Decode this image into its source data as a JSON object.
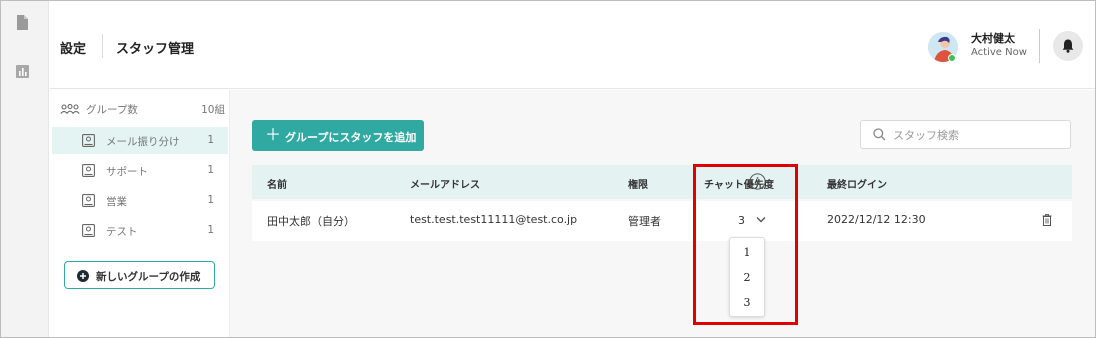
{
  "header": {
    "breadcrumb": [
      "設定",
      "スタッフ管理"
    ],
    "user": {
      "name": "大村健太",
      "status": "Active Now"
    }
  },
  "rail": {
    "icons": [
      "document-icon",
      "chart-icon"
    ]
  },
  "groups_panel": {
    "header_label": "グループ数",
    "count": "10組",
    "items": [
      {
        "label": "メール振り分け",
        "count": "1",
        "active": true
      },
      {
        "label": "サポート",
        "count": "1",
        "active": false
      },
      {
        "label": "営業",
        "count": "1",
        "active": false
      },
      {
        "label": "テスト",
        "count": "1",
        "active": false
      }
    ],
    "new_group_button": "新しいグループの作成"
  },
  "main": {
    "add_staff_button": "グループにスタッフを追加",
    "search_placeholder": "スタッフ検索",
    "table": {
      "columns": [
        "名前",
        "メールアドレス",
        "権限",
        "チャット優先度",
        "最終ログイン"
      ],
      "rows": [
        {
          "name": "田中太郎（自分）",
          "email": "test.test.test11111@test.co.jp",
          "role": "管理者",
          "priority": "3",
          "last_login": "2022/12/12 12:30"
        }
      ]
    },
    "priority_options": [
      "1",
      "2",
      "3"
    ]
  },
  "colors": {
    "accent": "#30a9a2",
    "highlight": "#e00000",
    "active_row": "#e3f4f3",
    "table_header": "#e4f3f2"
  }
}
